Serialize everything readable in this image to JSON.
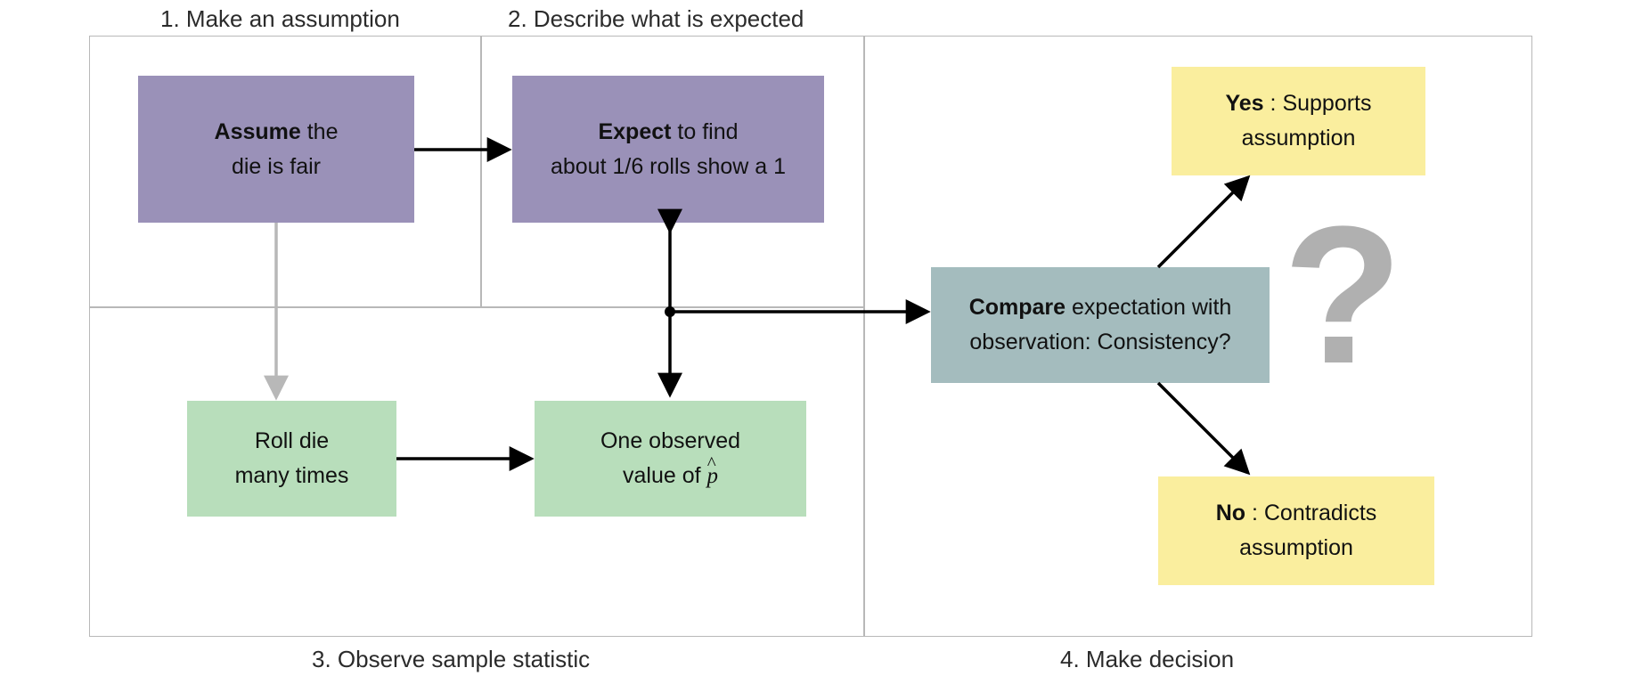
{
  "labels": {
    "z1": "1. Make an assumption",
    "z2": "2. Describe what is expected",
    "z3": "3. Observe sample statistic",
    "z4": "4. Make decision"
  },
  "nodes": {
    "assume": {
      "b": "Assume",
      "l1_rest": " the",
      "l2": "die is fair"
    },
    "expect": {
      "b": "Expect",
      "l1_rest": " to find",
      "l2": "about 1/6 rolls show a 1"
    },
    "roll": {
      "l1": "Roll die",
      "l2": "many times"
    },
    "observe": {
      "l1": "One observed",
      "l2_pre": "value of "
    },
    "compare": {
      "b": "Compare",
      "l1_rest": " expectation with",
      "l2": "observation: Consistency?"
    },
    "yes": {
      "b": "Yes",
      "sep": " :  ",
      "rest": "Supports",
      "l2": "assumption"
    },
    "no": {
      "b": "No",
      "sep": " :  ",
      "rest": "Contradicts",
      "l2": "assumption"
    }
  },
  "qmark": "?"
}
